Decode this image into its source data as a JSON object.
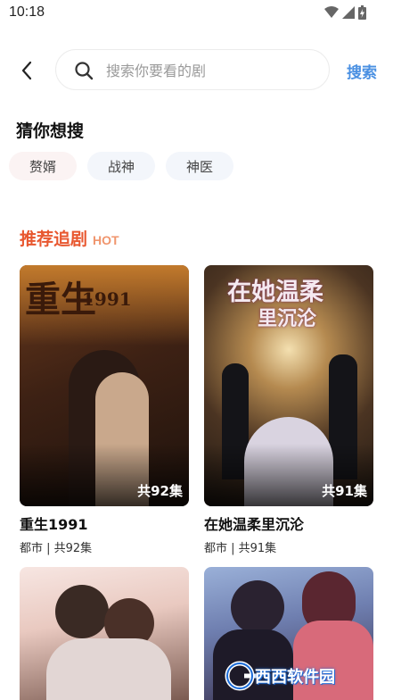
{
  "status_bar": {
    "time": "10:18"
  },
  "search": {
    "placeholder": "搜索你要看的剧",
    "action_label": "搜索"
  },
  "guess": {
    "title": "猜你想搜",
    "chips": [
      "赘婿",
      "战神",
      "神医"
    ]
  },
  "recommend": {
    "title": "推荐追剧",
    "tag": "HOT",
    "items": [
      {
        "title": "重生1991",
        "meta": "都市 | 共92集",
        "episodes": "共92集",
        "poster_text": "重生",
        "poster_sub": "1991"
      },
      {
        "title": "在她温柔里沉沦",
        "meta": "都市 | 共91集",
        "episodes": "共91集",
        "poster_text": "在她温柔",
        "poster_sub": "里沉沦"
      },
      {
        "title": "",
        "meta": "",
        "episodes": ""
      },
      {
        "title": "",
        "meta": "",
        "episodes": ""
      }
    ]
  },
  "watermark": {
    "text": "西西软件园"
  },
  "colors": {
    "accent": "#e8572f",
    "link": "#4a90e2",
    "chip_bg": "#f4f6fa"
  }
}
